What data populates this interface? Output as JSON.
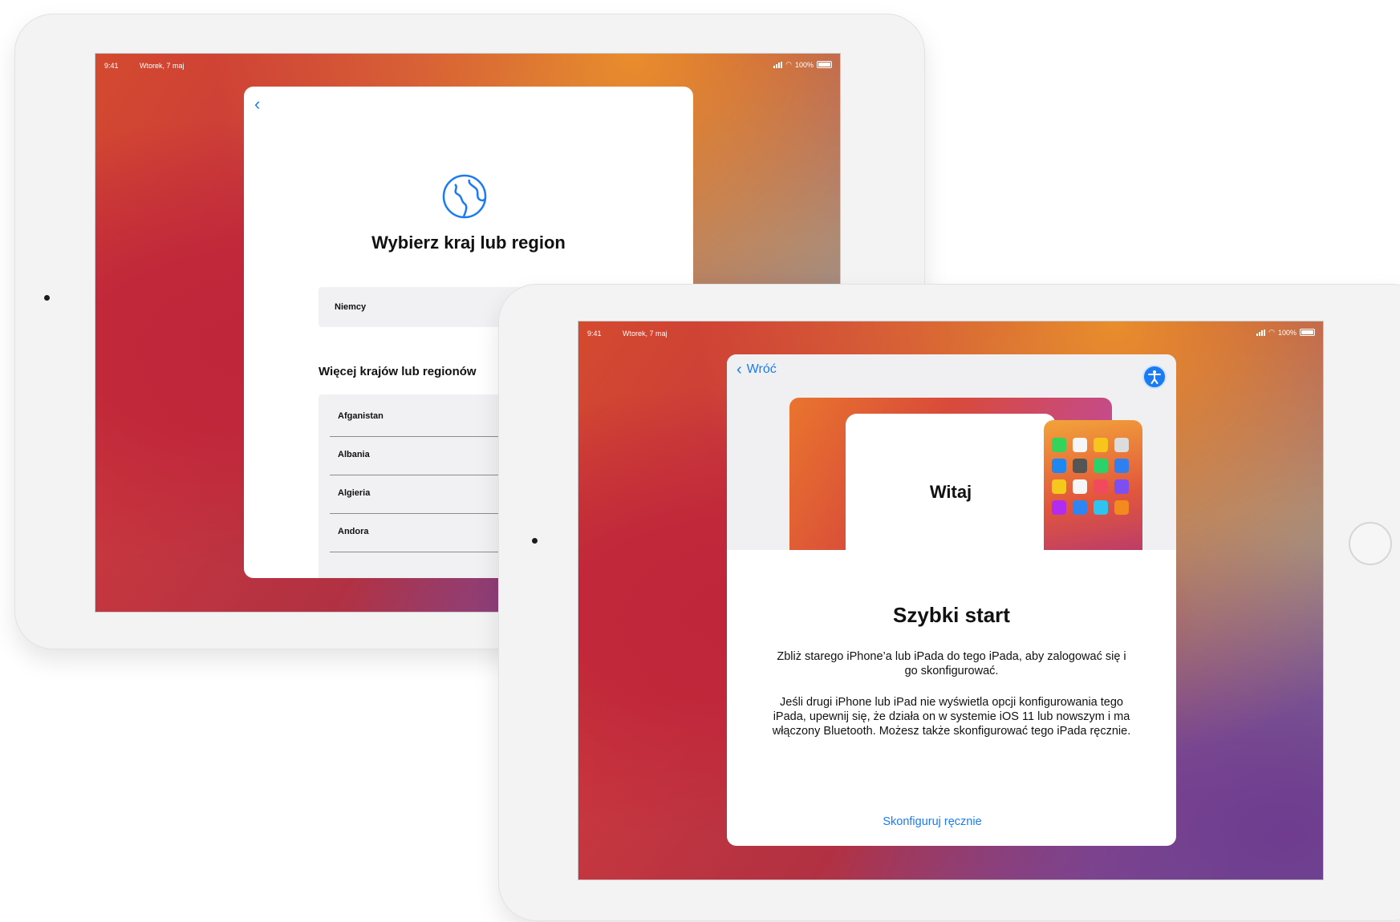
{
  "back_ipad": {
    "status": {
      "time": "9:41",
      "date": "Wtorek, 7 maj",
      "battery": "100%"
    },
    "title": "Wybierz kraj lub region",
    "selected_country": "Niemcy",
    "more_header": "Więcej krajów lub regionów",
    "countries": [
      "Afganistan",
      "Albania",
      "Algieria",
      "Andora"
    ]
  },
  "front_ipad": {
    "status": {
      "time": "9:41",
      "date": "Wtorek, 7 maj",
      "battery": "100%"
    },
    "back_label": "Wróć",
    "hero_card_title": "Witaj",
    "title": "Szybki start",
    "paragraph1": "Zbliż starego iPhone’a lub iPada do tego iPada, aby zalogować się i go skonfigurować.",
    "paragraph2": "Jeśli drugi iPhone lub iPad nie wyświetla opcji konfigurowania tego iPada, upewnij się, że działa on w systemie iOS 11 lub nowszym i ma włączony Bluetooth. Możesz także skonfigurować tego iPada ręcznie.",
    "manual_link": "Skonfiguruj ręcznie"
  },
  "colors": {
    "accent": "#1a7cf0",
    "sheet": "#ffffff",
    "row_bg": "#f1f1f3"
  }
}
